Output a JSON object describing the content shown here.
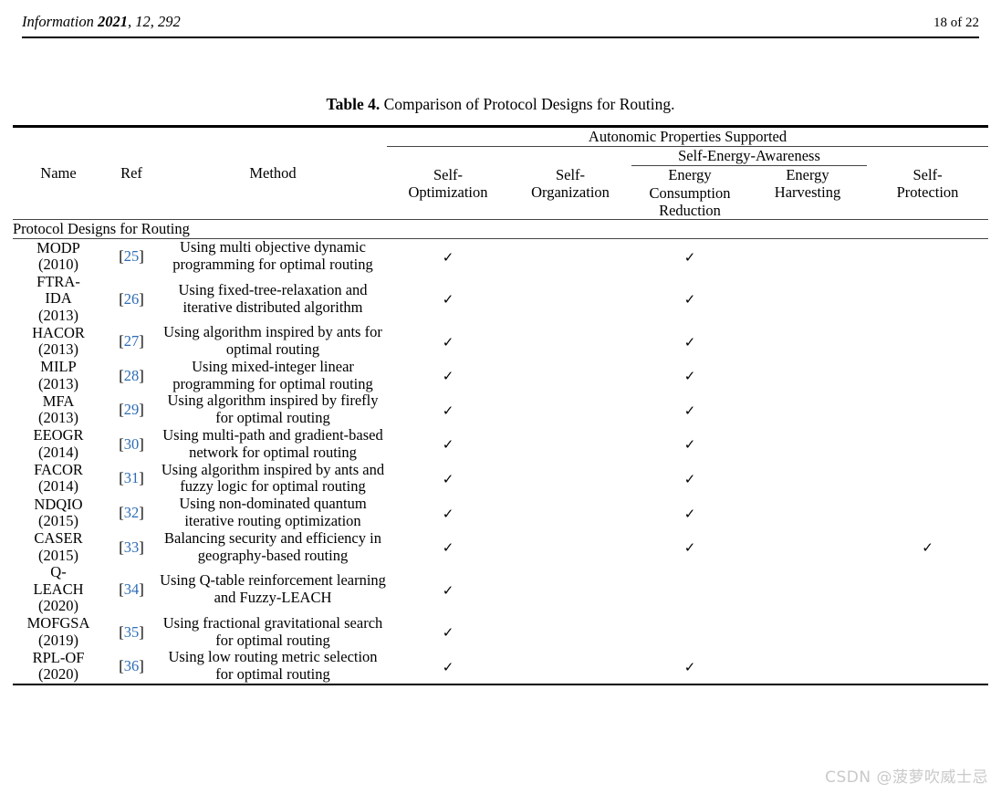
{
  "page_header": {
    "journal_name": "Information",
    "issue": "2021",
    "volume_issue": ", 12, 292",
    "page_number": "18 of 22"
  },
  "caption": {
    "label": "Table 4.",
    "text": " Comparison of Protocol Designs for Routing."
  },
  "table": {
    "group_header": "Autonomic Properties Supported",
    "subgroup_header": "Self-Energy-Awareness",
    "columns": {
      "name": "Name",
      "ref": "Ref",
      "method": "Method",
      "self_optimization": "Self-\nOptimization",
      "self_optimization_l1": "Self-",
      "self_optimization_l2": "Optimization",
      "self_organization_l1": "Self-",
      "self_organization_l2": "Organization",
      "energy_consumption_l1": "Energy",
      "energy_consumption_l2": "Consumption",
      "energy_consumption_l3": "Reduction",
      "energy_harvesting_l1": "Energy",
      "energy_harvesting_l2": "Harvesting",
      "self_protection_l1": "Self-",
      "self_protection_l2": "Protection"
    },
    "section_label": "Protocol Designs for Routing",
    "check_symbol": "✓",
    "ref_link_color": "#2d6cb5",
    "rows": [
      {
        "name_l1": "MODP",
        "name_l2": "(2010)",
        "ref": "25",
        "method": "Using multi objective dynamic programming for optimal routing",
        "self_optimization": "✓",
        "self_organization": "",
        "energy_consumption_reduction": "✓",
        "energy_harvesting": "",
        "self_protection": ""
      },
      {
        "name_l1": "FTRA-",
        "name_l2": "IDA",
        "name_l3": "(2013)",
        "ref": "26",
        "method": "Using fixed-tree-relaxation and iterative distributed algorithm",
        "self_optimization": "✓",
        "self_organization": "",
        "energy_consumption_reduction": "✓",
        "energy_harvesting": "",
        "self_protection": ""
      },
      {
        "name_l1": "HACOR",
        "name_l2": "(2013)",
        "ref": "27",
        "method": "Using algorithm inspired by ants for optimal routing",
        "self_optimization": "✓",
        "self_organization": "",
        "energy_consumption_reduction": "✓",
        "energy_harvesting": "",
        "self_protection": ""
      },
      {
        "name_l1": "MILP",
        "name_l2": "(2013)",
        "ref": "28",
        "method": "Using mixed-integer linear programming for optimal routing",
        "self_optimization": "✓",
        "self_organization": "",
        "energy_consumption_reduction": "✓",
        "energy_harvesting": "",
        "self_protection": ""
      },
      {
        "name_l1": "MFA",
        "name_l2": "(2013)",
        "ref": "29",
        "method": "Using algorithm inspired by firefly for optimal routing",
        "self_optimization": "✓",
        "self_organization": "",
        "energy_consumption_reduction": "✓",
        "energy_harvesting": "",
        "self_protection": ""
      },
      {
        "name_l1": "EEOGR",
        "name_l2": "(2014)",
        "ref": "30",
        "method": "Using multi-path and gradient-based network for optimal routing",
        "self_optimization": "✓",
        "self_organization": "",
        "energy_consumption_reduction": "✓",
        "energy_harvesting": "",
        "self_protection": ""
      },
      {
        "name_l1": "FACOR",
        "name_l2": "(2014)",
        "ref": "31",
        "method": "Using algorithm inspired by ants and fuzzy logic for optimal routing",
        "self_optimization": "✓",
        "self_organization": "",
        "energy_consumption_reduction": "✓",
        "energy_harvesting": "",
        "self_protection": ""
      },
      {
        "name_l1": "NDQIO",
        "name_l2": "(2015)",
        "ref": "32",
        "method": "Using non-dominated quantum iterative routing optimization",
        "self_optimization": "✓",
        "self_organization": "",
        "energy_consumption_reduction": "✓",
        "energy_harvesting": "",
        "self_protection": ""
      },
      {
        "name_l1": "CASER",
        "name_l2": "(2015)",
        "ref": "33",
        "method": "Balancing security and efficiency in geography-based routing",
        "self_optimization": "✓",
        "self_organization": "",
        "energy_consumption_reduction": "✓",
        "energy_harvesting": "",
        "self_protection": "✓"
      },
      {
        "name_l1": "Q-",
        "name_l2": "LEACH",
        "name_l3": "(2020)",
        "ref": "34",
        "method": "Using Q-table reinforcement learning and Fuzzy-LEACH",
        "self_optimization": "✓",
        "self_organization": "",
        "energy_consumption_reduction": "",
        "energy_harvesting": "",
        "self_protection": ""
      },
      {
        "name_l1": "MOFGSA",
        "name_l2": "(2019)",
        "ref": "35",
        "method": "Using fractional gravitational search for optimal routing",
        "self_optimization": "✓",
        "self_organization": "",
        "energy_consumption_reduction": "",
        "energy_harvesting": "",
        "self_protection": ""
      },
      {
        "name_l1": "RPL-OF",
        "name_l2": "(2020)",
        "ref": "36",
        "method": "Using low routing metric selection for optimal routing",
        "self_optimization": "✓",
        "self_organization": "",
        "energy_consumption_reduction": "✓",
        "energy_harvesting": "",
        "self_protection": ""
      }
    ]
  },
  "watermark": "CSDN @菠萝吹威士忌"
}
